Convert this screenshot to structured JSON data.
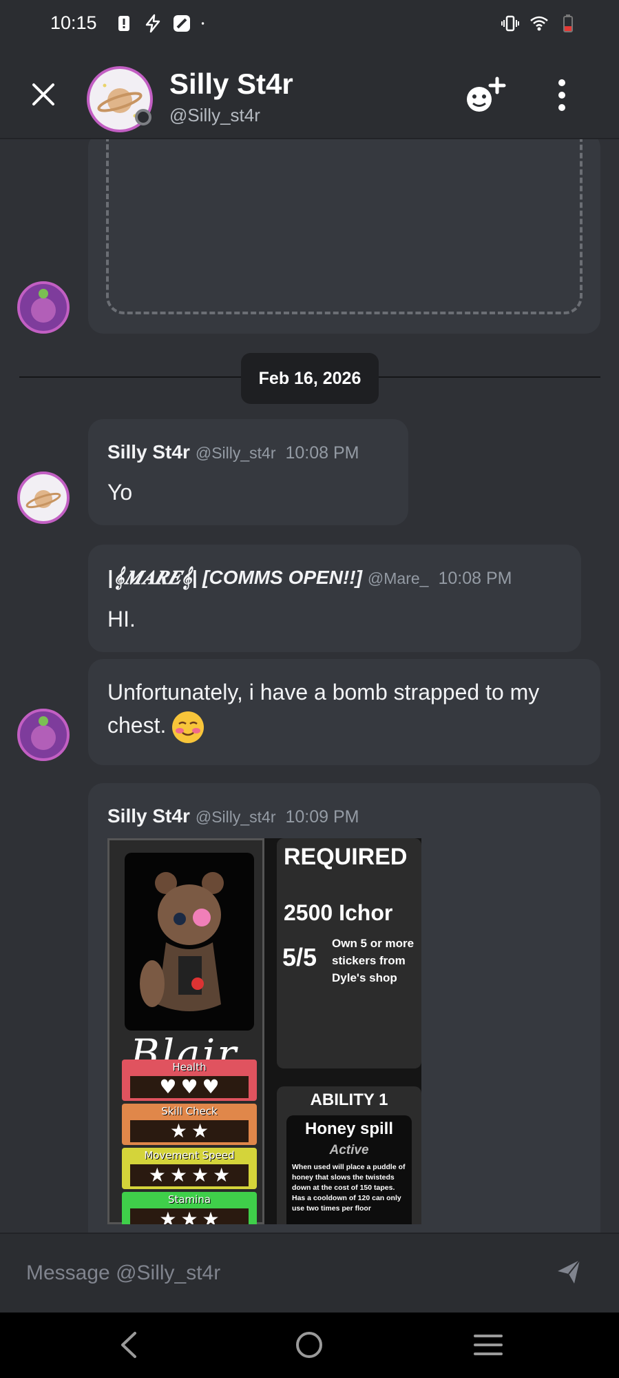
{
  "status_bar": {
    "time": "10:15",
    "left_icons": [
      "alert-icon",
      "flash-icon",
      "app-icon",
      "dot-icon"
    ],
    "right_icons": [
      "vibrate-icon",
      "wifi-icon",
      "battery-icon"
    ]
  },
  "header": {
    "name": "Silly St4r",
    "handle": "@Silly_st4r"
  },
  "date_divider": "Feb 16, 2026",
  "messages": [
    {
      "name": "Silly St4r",
      "handle": "@Silly_st4r",
      "time": "10:08 PM",
      "text": "Yo"
    },
    {
      "name": "|𝄞𝑴𝑨𝑹𝑬𝄞| [COMMS OPEN!!]",
      "handle": "@Mare_",
      "time": "10:08 PM",
      "text": "HI."
    },
    {
      "text": "Unfortunately, i have a bomb strapped to my chest."
    },
    {
      "name": "Silly St4r",
      "handle": "@Silly_st4r",
      "time": "10:09 PM"
    }
  ],
  "card": {
    "character_name": "Blair",
    "stats": [
      {
        "label": "Health",
        "value": 3,
        "max": 5,
        "color": "#e0535f",
        "symbol": "♥"
      },
      {
        "label": "Skill Check",
        "value": 2,
        "max": 5,
        "color": "#e0874a",
        "symbol": "★"
      },
      {
        "label": "Movement Speed",
        "value": 4,
        "max": 5,
        "color": "#d4d43a",
        "symbol": "★"
      },
      {
        "label": "Stamina",
        "value": 3,
        "max": 5,
        "color": "#3fcf4a",
        "symbol": "★"
      }
    ],
    "required_title": "REQUIRED",
    "ichor": "2500 Ichor",
    "stickers_count": "5/5",
    "stickers_desc": "Own 5 or more stickers from Dyle's shop",
    "ability_title": "ABILITY 1",
    "ability_name": "Honey spill",
    "ability_type": "Active",
    "ability_desc": "When used will place a puddle of honey that slows the twisteds down at the cost of 150 tapes. Has a cooldown of 120 can only use two times per floor"
  },
  "composer": {
    "placeholder": "Message @Silly_st4r"
  },
  "nav": [
    "back-icon",
    "home-icon",
    "recents-icon"
  ]
}
